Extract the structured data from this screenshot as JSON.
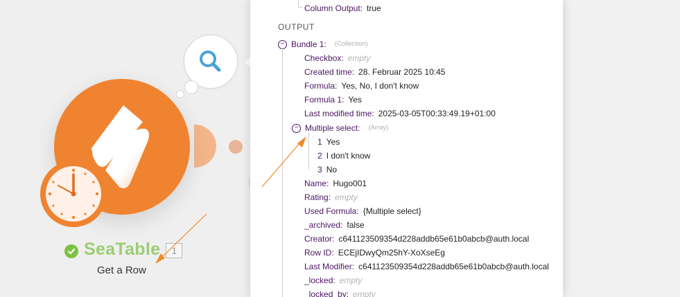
{
  "module": {
    "name": "SeaTable",
    "badge": "1",
    "action": "Get a Row",
    "colors": {
      "orange": "#f08330",
      "green": "#7cc242",
      "name": "#9ccc75",
      "search": "#4aa3d4"
    }
  },
  "panel": {
    "top_row": {
      "key": "Column Output:",
      "value": "true"
    },
    "section": "OUTPUT",
    "bundle": {
      "key": "Bundle 1:",
      "type": "(Collection)"
    },
    "fields": [
      {
        "key": "Checkbox:",
        "value": "empty",
        "empty": true
      },
      {
        "key": "Created time:",
        "value": "28. Februar 2025 10:45"
      },
      {
        "key": "Formula:",
        "value": "Yes, No, I don't know"
      },
      {
        "key": "Formula 1:",
        "value": "Yes"
      },
      {
        "key": "Last modified time:",
        "value": "2025-03-05T00:33:49.19+01:00"
      }
    ],
    "multi": {
      "key": "Multiple select:",
      "type": "(Array)",
      "items": [
        {
          "index": "1",
          "value": "Yes"
        },
        {
          "index": "2",
          "value": "I don't know"
        },
        {
          "index": "3",
          "value": "No"
        }
      ]
    },
    "fields2": [
      {
        "key": "Name:",
        "value": "Hugo001"
      },
      {
        "key": "Rating:",
        "value": "empty",
        "empty": true
      },
      {
        "key": "Used Formula:",
        "value": "{Multiple select}"
      },
      {
        "key": "_archived:",
        "value": "false"
      },
      {
        "key": "Creator:",
        "value": "c641123509354d228addb65e61b0abcb@auth.local"
      },
      {
        "key": "Row ID:",
        "value": "ECEjIDwyQm25hY-XoXseEg"
      },
      {
        "key": "Last Modifier:",
        "value": "c641123509354d228addb65e61b0abcb@auth.local"
      },
      {
        "key": "_locked:",
        "value": "empty",
        "empty": true
      },
      {
        "key": "_locked_by:",
        "value": "empty",
        "empty": true
      }
    ]
  },
  "annotation_color": "#f08a2c"
}
